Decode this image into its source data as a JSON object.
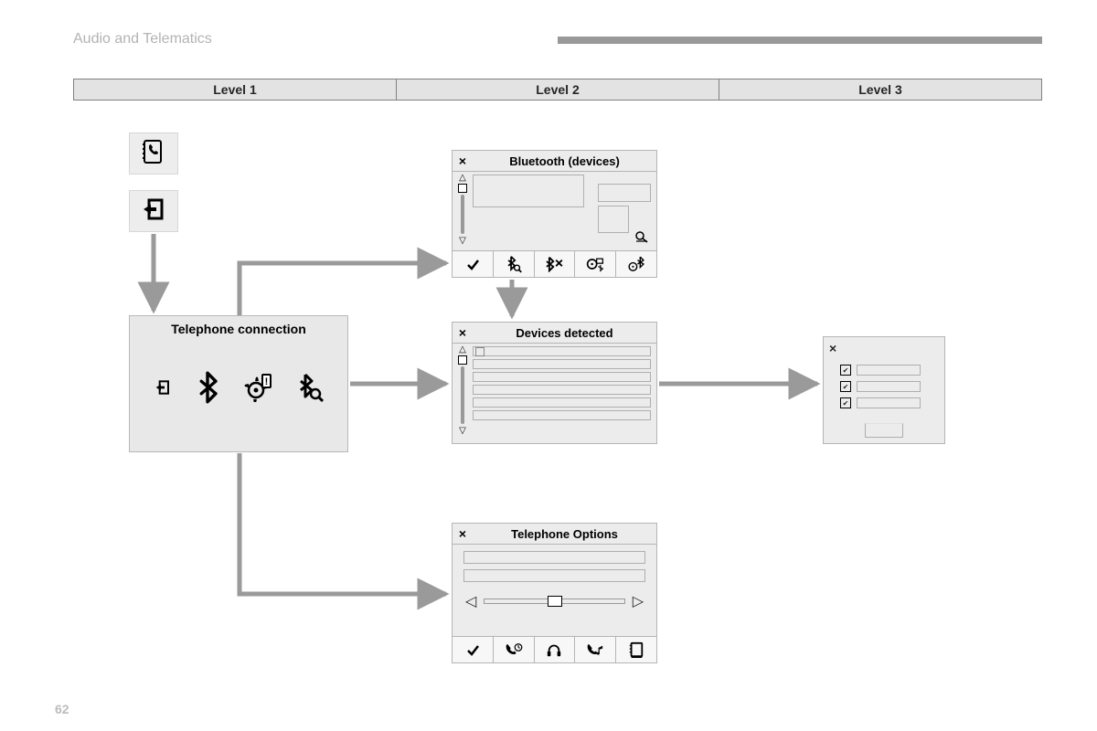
{
  "header": {
    "section_title": "Audio and Telematics",
    "page_number": "62"
  },
  "levels": [
    "Level 1",
    "Level 2",
    "Level 3"
  ],
  "icon_tiles": {
    "phone_book": "phone-book-icon",
    "exit": "exit-icon"
  },
  "telephone_connection": {
    "title": "Telephone connection",
    "icons": [
      "exit-icon",
      "bluetooth-icon",
      "settings-alert-icon",
      "bluetooth-search-icon"
    ]
  },
  "bluetooth_devices": {
    "title": "Bluetooth (devices)",
    "close": "×",
    "toolbar": [
      "check-icon",
      "bluetooth-search-icon",
      "bluetooth-disconnect-icon",
      "media-bluetooth-icon",
      "bluetooth-settings-icon"
    ]
  },
  "devices_detected": {
    "title": "Devices detected",
    "close": "×",
    "row_count": 6
  },
  "telephone_options": {
    "title": "Telephone Options",
    "close": "×",
    "toolbar": [
      "check-icon",
      "call-history-icon",
      "headphones-icon",
      "ringtone-icon",
      "contacts-icon"
    ]
  },
  "level3_panel": {
    "close": "×",
    "item_count": 3
  }
}
